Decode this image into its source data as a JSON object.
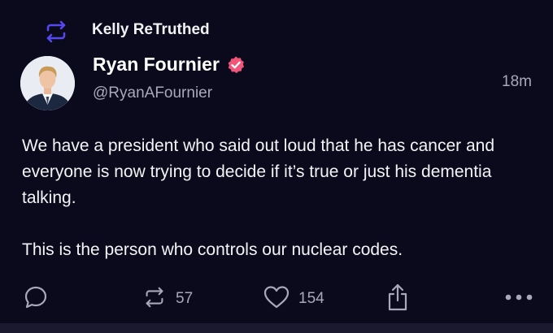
{
  "retruth": {
    "icon": "retruth-icon",
    "label": "Kelly ReTruthed"
  },
  "post": {
    "author": {
      "display_name": "Ryan Fournier",
      "handle": "@RyanAFournier",
      "verified": true,
      "avatar": "avatar"
    },
    "timestamp": "18m",
    "body": {
      "paragraph_1": "We have a president who said out loud that he has cancer and everyone is now trying to decide if it’s true or just his dementia talking.",
      "paragraph_2": "This is the person who controls our nuclear codes."
    },
    "actions": {
      "reply": {
        "icon": "reply-icon"
      },
      "retruth": {
        "icon": "retruth-icon",
        "count": "57"
      },
      "like": {
        "icon": "heart-icon",
        "count": "154"
      },
      "share": {
        "icon": "share-icon"
      },
      "more": {
        "icon": "more-icon"
      }
    }
  },
  "colors": {
    "background": "#0b0a1c",
    "accent": "#5448ee",
    "verified": "#f2547a",
    "muted_text": "#a8a8b8"
  }
}
